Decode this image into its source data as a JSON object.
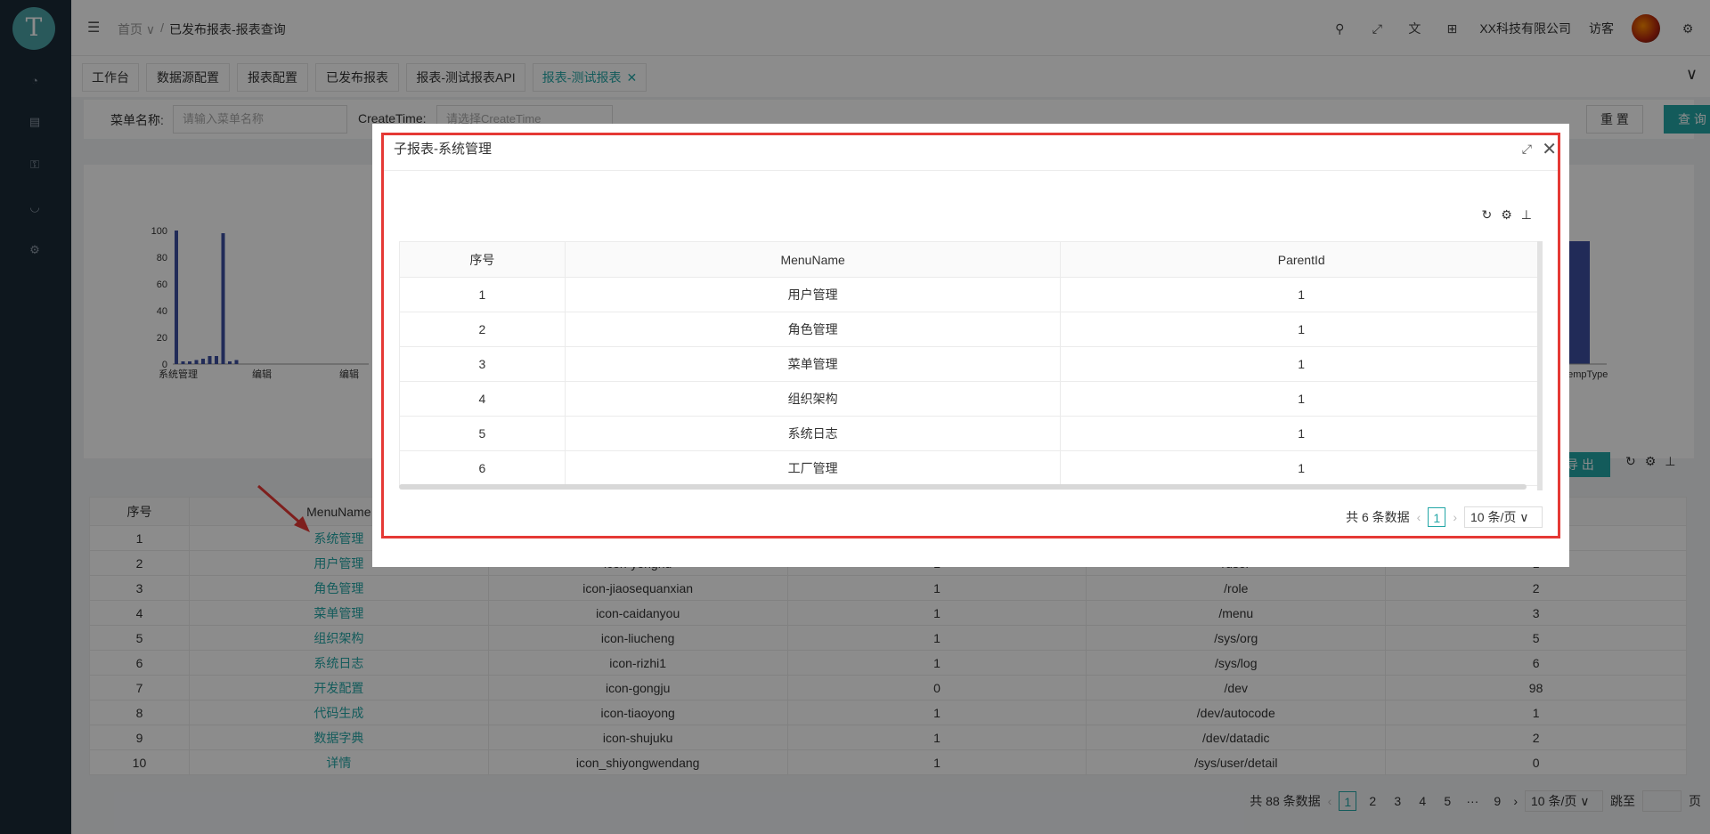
{
  "app": {
    "logo": "T"
  },
  "sidebar": {
    "icons": [
      {
        "name": "dashboard-icon",
        "glyph": "◔"
      },
      {
        "name": "chart-icon",
        "glyph": "▤"
      },
      {
        "name": "key-icon",
        "glyph": "⚿"
      },
      {
        "name": "gauge-icon",
        "glyph": "◡"
      },
      {
        "name": "settings-icon",
        "glyph": "⚙"
      }
    ]
  },
  "header": {
    "breadcrumb": {
      "home": "首页 ∨",
      "sep": "/",
      "current": "已发布报表-报表查询"
    },
    "company": "XX科技有限公司",
    "user": "访客",
    "icons": {
      "search": "⚲",
      "fullscreen": "⤢",
      "translate": "文",
      "layout": "⊞",
      "settings": "⚙"
    }
  },
  "tabs": [
    {
      "label": "工作台",
      "active": false
    },
    {
      "label": "数据源配置",
      "active": false
    },
    {
      "label": "报表配置",
      "active": false
    },
    {
      "label": "已发布报表",
      "active": false
    },
    {
      "label": "报表-测试报表API",
      "active": false
    },
    {
      "label": "报表-测试报表",
      "active": true,
      "close": "✕"
    }
  ],
  "search": {
    "menu_label": "菜单名称:",
    "menu_placeholder": "请输入菜单名称",
    "time_label": "CreateTime:",
    "time_placeholder": "请选择CreateTime",
    "reset": "重 置",
    "query": "查 询"
  },
  "chart_data": {
    "type": "bar",
    "yticks": [
      "0",
      "20",
      "40",
      "60",
      "80",
      "100"
    ],
    "ylim": [
      0,
      100
    ],
    "x_labels": [
      "系统管理",
      "编辑",
      "编辑"
    ],
    "right_label": "TempType",
    "series": [
      {
        "values": [
          100,
          2,
          2,
          3,
          4,
          6,
          6,
          98,
          2,
          3
        ]
      }
    ]
  },
  "toolbar": {
    "export": "导 出"
  },
  "main_table": {
    "columns": [
      "序号",
      "MenuName",
      "",
      "",
      "",
      ""
    ],
    "rows": [
      [
        "1",
        "系统管理",
        "",
        "",
        "",
        ""
      ],
      [
        "2",
        "用户管理",
        "icon-yonghu",
        "1",
        "/user",
        "1"
      ],
      [
        "3",
        "角色管理",
        "icon-jiaosequanxian",
        "1",
        "/role",
        "2"
      ],
      [
        "4",
        "菜单管理",
        "icon-caidanyou",
        "1",
        "/menu",
        "3"
      ],
      [
        "5",
        "组织架构",
        "icon-liucheng",
        "1",
        "/sys/org",
        "5"
      ],
      [
        "6",
        "系统日志",
        "icon-rizhi1",
        "1",
        "/sys/log",
        "6"
      ],
      [
        "7",
        "开发配置",
        "icon-gongju",
        "0",
        "/dev",
        "98"
      ],
      [
        "8",
        "代码生成",
        "icon-tiaoyong",
        "1",
        "/dev/autocode",
        "1"
      ],
      [
        "9",
        "数据字典",
        "icon-shujuku",
        "1",
        "/dev/datadic",
        "2"
      ],
      [
        "10",
        "详情",
        "icon_shiyongwendang",
        "1",
        "/sys/user/detail",
        "0"
      ]
    ]
  },
  "pager": {
    "total": "共 88 条数据",
    "pages": [
      "1",
      "2",
      "3",
      "4",
      "5",
      "···",
      "9"
    ],
    "size": "10 条/页 ∨",
    "jump": "跳至",
    "page_unit": "页"
  },
  "modal": {
    "title": "子报表-系统管理",
    "columns": [
      "序号",
      "MenuName",
      "ParentId"
    ],
    "rows": [
      [
        "1",
        "用户管理",
        "1"
      ],
      [
        "2",
        "角色管理",
        "1"
      ],
      [
        "3",
        "菜单管理",
        "1"
      ],
      [
        "4",
        "组织架构",
        "1"
      ],
      [
        "5",
        "系统日志",
        "1"
      ],
      [
        "6",
        "工厂管理",
        "1"
      ]
    ],
    "pager": {
      "total": "共 6 条数据",
      "page": "1",
      "size": "10 条/页 ∨"
    },
    "accent": "#e53935"
  }
}
